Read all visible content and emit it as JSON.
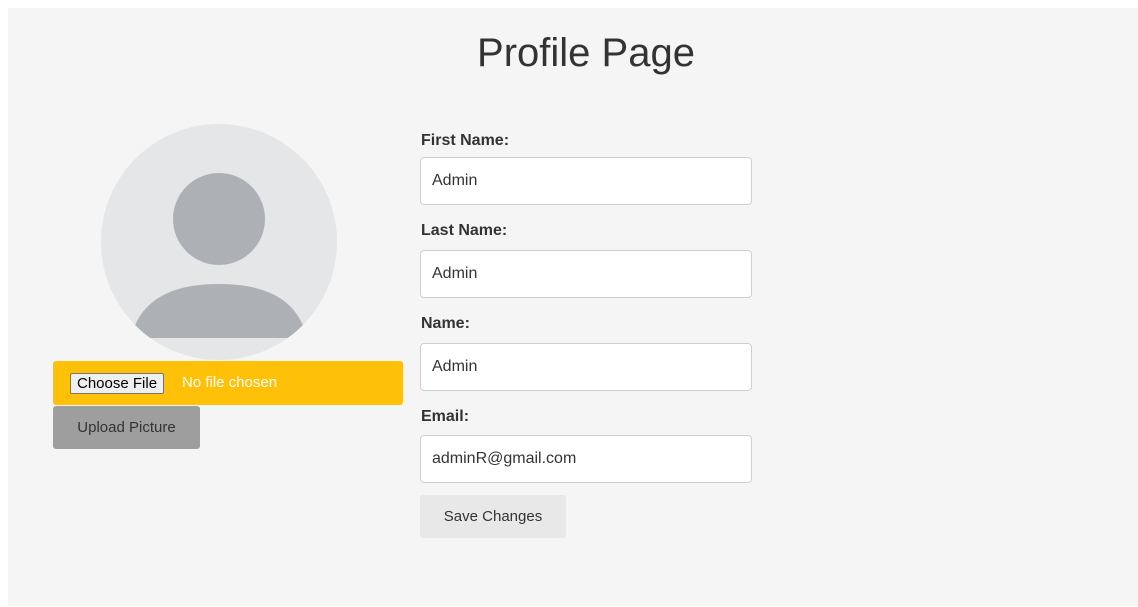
{
  "page": {
    "title": "Profile Page"
  },
  "avatar": {
    "icon": "default-user-avatar"
  },
  "upload": {
    "choose_file_label": "Choose File",
    "status_text": "No file chosen",
    "upload_button_label": "Upload Picture",
    "bar_color": "#ffc107"
  },
  "form": {
    "first_name": {
      "label": "First Name:",
      "value": "Admin"
    },
    "last_name": {
      "label": "Last Name:",
      "value": "Admin"
    },
    "name": {
      "label": "Name:",
      "value": "Admin"
    },
    "email": {
      "label": "Email:",
      "value": "adminR@gmail.com"
    },
    "save_label": "Save Changes"
  }
}
